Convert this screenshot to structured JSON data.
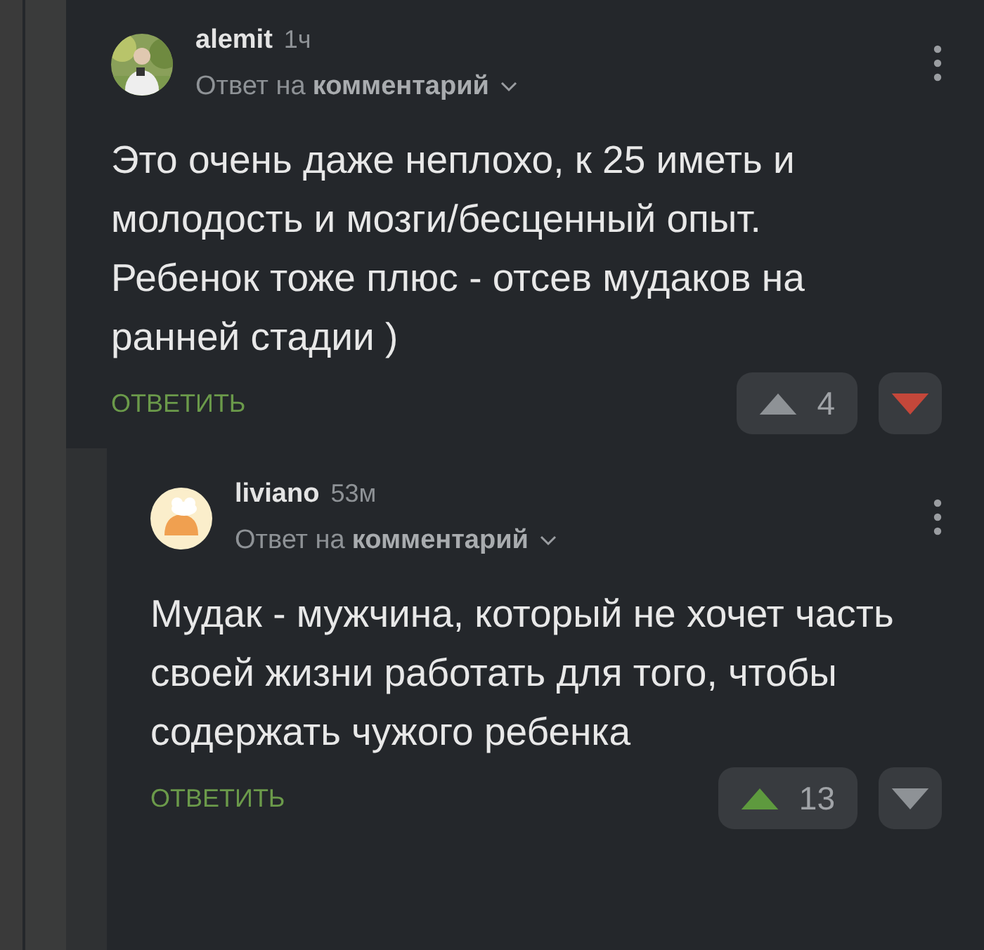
{
  "comments": [
    {
      "author": "alemit",
      "time": "1ч",
      "reply_prefix": "Ответ на",
      "reply_target": "комментарий",
      "text": "Это очень даже неплохо, к 25 иметь и молодость и мозги/бесценный опыт. Ребенок тоже плюс - отсев мудаков на ранней стадии )",
      "reply_label": "ОТВЕТИТЬ",
      "rating": "4",
      "upvoted": false,
      "downvoted": true
    },
    {
      "author": "liviano",
      "time": "53м",
      "reply_prefix": "Ответ на",
      "reply_target": "комментарий",
      "text": "Мудак - мужчина, который не хочет часть своей жизни работать для того, чтобы содержать чужого ребенка",
      "reply_label": "ОТВЕТИТЬ",
      "rating": "13",
      "upvoted": true,
      "downvoted": false
    }
  ]
}
